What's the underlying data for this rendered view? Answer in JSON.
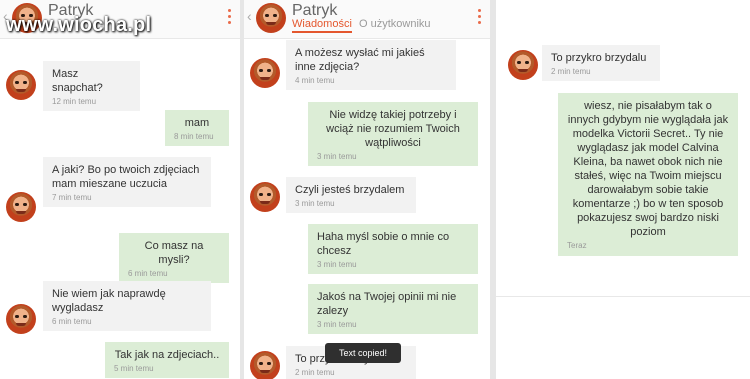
{
  "watermark": "www.wiocha.pl",
  "toast": "Text copied!",
  "header": {
    "name": "Patryk",
    "tab_active": "Wiadomości",
    "tab_other": "O użytkowniku",
    "back": "‹"
  },
  "panel1": [
    {
      "dir": "in",
      "text": "Masz snapchat?",
      "time": "12 min temu"
    },
    {
      "dir": "out",
      "text": "mam",
      "time": "8 min temu"
    },
    {
      "dir": "in",
      "text": "A jaki? Bo po twoich zdjęciach mam mieszane uczucia",
      "time": "7 min temu"
    },
    {
      "dir": "out",
      "text": "Co masz na mysli?",
      "time": "6 min temu"
    },
    {
      "dir": "in",
      "text": "Nie wiem jak naprawdę wygladasz",
      "time": "6 min temu"
    },
    {
      "dir": "out",
      "text": "Tak jak na zdjeciach..",
      "time": "5 min temu"
    }
  ],
  "panel2": [
    {
      "dir": "in",
      "text": "A możesz wysłać mi jakieś inne zdjęcia?",
      "time": "4 min temu"
    },
    {
      "dir": "out",
      "text": "Nie widzę takiej potrzeby i wciąż nie rozumiem Twoich wątpliwości",
      "time": "3 min temu"
    },
    {
      "dir": "in",
      "text": "Czyli jesteś brzydalem",
      "time": "3 min temu"
    },
    {
      "dir": "out",
      "text": "Haha myśl sobie o mnie co chcesz",
      "time": "3 min temu"
    },
    {
      "dir": "out",
      "text": "Jakoś na Twojej opinii mi nie zalezy",
      "time": "3 min temu"
    },
    {
      "dir": "in",
      "text": "To przykro brzydalu",
      "time": "2 min temu"
    }
  ],
  "panel3": [
    {
      "dir": "in",
      "text": "To przykro brzydalu",
      "time": "2 min temu"
    },
    {
      "dir": "out",
      "text": "wiesz, nie pisałabym tak o innych gdybym nie wyglądała jak modelka Victorii Secret.. Ty nie wyglądasz jak model Calvina Kleina, ba nawet obok nich nie stałeś, więc na Twoim miejscu darowałabym sobie takie komentarze ;) bo w ten sposob pokazujesz swoj bardzo niski poziom",
      "time": "Teraz"
    }
  ]
}
